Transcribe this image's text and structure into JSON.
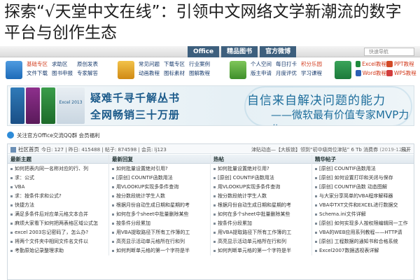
{
  "headline": "探索“√天堂中文在线”：引领中文网络文学新潮流的数字平台与创作生态",
  "topnav": {
    "tabs": [
      "Office",
      "精品图书",
      "官方微博"
    ],
    "search_placeholder": "快速导航"
  },
  "iconnav": {
    "group1": [
      "基础专区",
      "求助区",
      "原创发表",
      "文件下载",
      "图书申报",
      "专家解答"
    ],
    "group2": [
      "常见问题",
      "下载专区",
      "行业案例",
      "动画教程",
      "图标素材",
      "图解教程"
    ],
    "group3": [
      "个人空间",
      "每日打卡",
      "积分乐园",
      "版主申请",
      "月度评优",
      "学习课程"
    ],
    "wps": [
      "Excel教程",
      "PPT教程",
      "Word教程",
      "WPS教程"
    ]
  },
  "banner": {
    "left_line1": "疑难千寻千解丛书",
    "left_line2": "全网畅销三十万册",
    "right_line1": "自信来自解决问题的能力",
    "right_line2": "——微软最有价值专家MVP力作",
    "book_cover_text": "Excel 2013"
  },
  "qqgroup": "关注官方Office交流QQ群 会员福利",
  "forum": {
    "crumb": "社区首页",
    "stats": "今日: 127 | 昨日: 415488 | 帖子: 874598 | 会员: lj123",
    "notice": "津贴动态—【大板锁】领到“初中级岗位津贴” 6 Tb 消费券",
    "notice_date": "(2019-12-1)",
    "expand": "展开",
    "columns": [
      {
        "head": "最新主题",
        "items": [
          "如何把表内同一名称对应的行、列",
          "求：公式",
          "VBA",
          "求：按条件求和公式?",
          "快捷方法",
          "满足多条件后对应单元格文本合并",
          "麻烦大家看下如何把两表格区域公式怎",
          "excel 2003忘记密码了，怎么办?",
          "将两个文件夹中相同文件名文件以",
          "考勤原始记录整理求助"
        ]
      },
      {
        "head": "最新回复",
        "items": [
          "如何批量设置绝对引用?",
          "[原创] COUNTIF函数用法",
          "用VLOOKUP实现多条件查询",
          "按分数段统计学生人数",
          "根据月份自动生成日期和星期的考",
          "如何在多个sheet中批量删除某些",
          "按条件分段累加",
          "用VBA提取路径下所有工作簿的工",
          "高亮显示活动单元格所在行和列",
          "如何判断单元格的第一个字符是半"
        ]
      },
      {
        "head": "热帖",
        "items": [
          "如何批量设置绝对引用?",
          "[原创] COUNTIF函数用法",
          "用VLOOKUP实现多条件查询",
          "按分数段统计学生人数",
          "根据月份自动生成日期和星期的考",
          "如何在多个sheet中批量删除某些",
          "按条件分段累加",
          "用VBA提取路径下所有工作簿的工",
          "高亮显示活动单元格所在行和列",
          "如何判断单元格的第一个字符是半"
        ]
      },
      {
        "head": "精华帖子",
        "items": [
          "[原创] COUNTIF函数用法",
          "[原创] 如何设置打印和关闭与保存",
          "[原创] COUNTIF函数 动态图解",
          "与大家分享简单的VBA程序解释器",
          "VBA中TXT文件和EXCEL进行数据交",
          "Schema.ini文件详解",
          "[原创] 如何实现多人按权限编辑同一工作",
          "VBA的WEB应用系列教程——HTTP请",
          "[原创] 工程数据的通知书和合格系统",
          "Excel2007数据透视表详解"
        ]
      }
    ]
  }
}
